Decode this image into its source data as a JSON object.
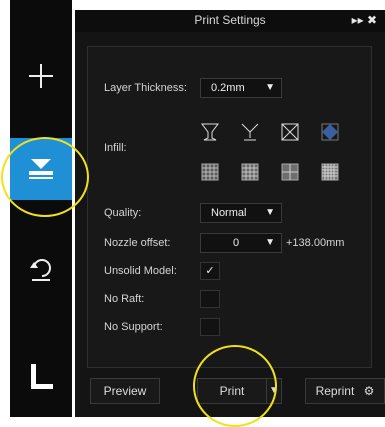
{
  "panel": {
    "title": "Print Settings",
    "title_icons": "▸▸  ✖"
  },
  "settings": {
    "layer_thickness_label": "Layer Thickness:",
    "layer_thickness_value": "0.2mm",
    "infill_label": "Infill:",
    "quality_label": "Quality:",
    "quality_value": "Normal",
    "nozzle_offset_label": "Nozzle offset:",
    "nozzle_offset_value": "0",
    "nozzle_offset_extra": "+138.00mm",
    "unsolid_label": "Unsolid Model:",
    "no_raft_label": "No Raft:",
    "no_support_label": "No Support:"
  },
  "buttons": {
    "preview": "Preview",
    "print": "Print",
    "reprint": "Reprint"
  },
  "colors": {
    "accent": "#1f8fd6",
    "annotation": "#f1e11a"
  }
}
